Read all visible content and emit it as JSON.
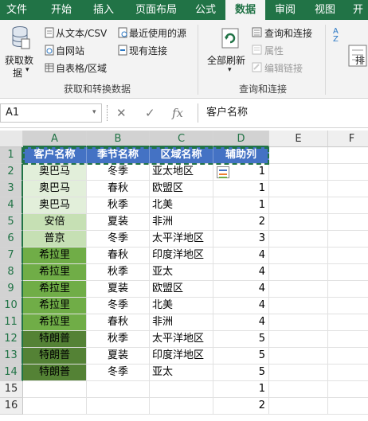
{
  "tabs": [
    "文件",
    "开始",
    "插入",
    "页面布局",
    "公式",
    "数据",
    "审阅",
    "视图",
    "开"
  ],
  "active_tab": "数据",
  "ribbon": {
    "get_data": {
      "line1": "获取数",
      "line2": "据"
    },
    "from_text": "从文本/CSV",
    "from_web": "自网站",
    "from_table": "自表格/区域",
    "recent_sources": "最近使用的源",
    "existing_conn": "现有连接",
    "group1_label": "获取和转换数据",
    "refresh_all": "全部刷新",
    "queries_conn": "查询和连接",
    "properties": "属性",
    "edit_links": "编辑链接",
    "group2_label": "查询和连接",
    "sort_label": "排"
  },
  "formula_bar": {
    "name_box": "A1",
    "cancel": "✕",
    "enter": "✓",
    "fx": "fx",
    "content": "客户名称"
  },
  "grid": {
    "columns": [
      "A",
      "B",
      "C",
      "D",
      "E",
      "F"
    ],
    "header_row": [
      "客户名称",
      "季节名称",
      "区域名称",
      "辅助列"
    ],
    "rows": [
      [
        "奥巴马",
        "冬季",
        "亚太地区",
        "1"
      ],
      [
        "奥巴马",
        "春秋",
        "欧盟区",
        "1"
      ],
      [
        "奥巴马",
        "秋季",
        "北美",
        "1"
      ],
      [
        "安倍",
        "夏装",
        "非洲",
        "2"
      ],
      [
        "普京",
        "冬季",
        "太平洋地区",
        "3"
      ],
      [
        "希拉里",
        "春秋",
        "印度洋地区",
        "4"
      ],
      [
        "希拉里",
        "秋季",
        "亚太",
        "4"
      ],
      [
        "希拉里",
        "夏装",
        "欧盟区",
        "4"
      ],
      [
        "希拉里",
        "冬季",
        "北美",
        "4"
      ],
      [
        "希拉里",
        "春秋",
        "非洲",
        "4"
      ],
      [
        "特朗普",
        "秋季",
        "太平洋地区",
        "5"
      ],
      [
        "特朗普",
        "夏装",
        "印度洋地区",
        "5"
      ],
      [
        "特朗普",
        "冬季",
        "亚太",
        "5"
      ],
      [
        "",
        "",
        "",
        "1"
      ],
      [
        "",
        "",
        "",
        "2"
      ]
    ]
  },
  "colors": {
    "excel_green": "#217346",
    "header_blue": "#4472c4",
    "group_light": "#e2efda",
    "group_mid": "#c6e0b4",
    "group_dark": "#a9d08e",
    "group_darker": "#70ad47",
    "group_darkest": "#548235"
  }
}
